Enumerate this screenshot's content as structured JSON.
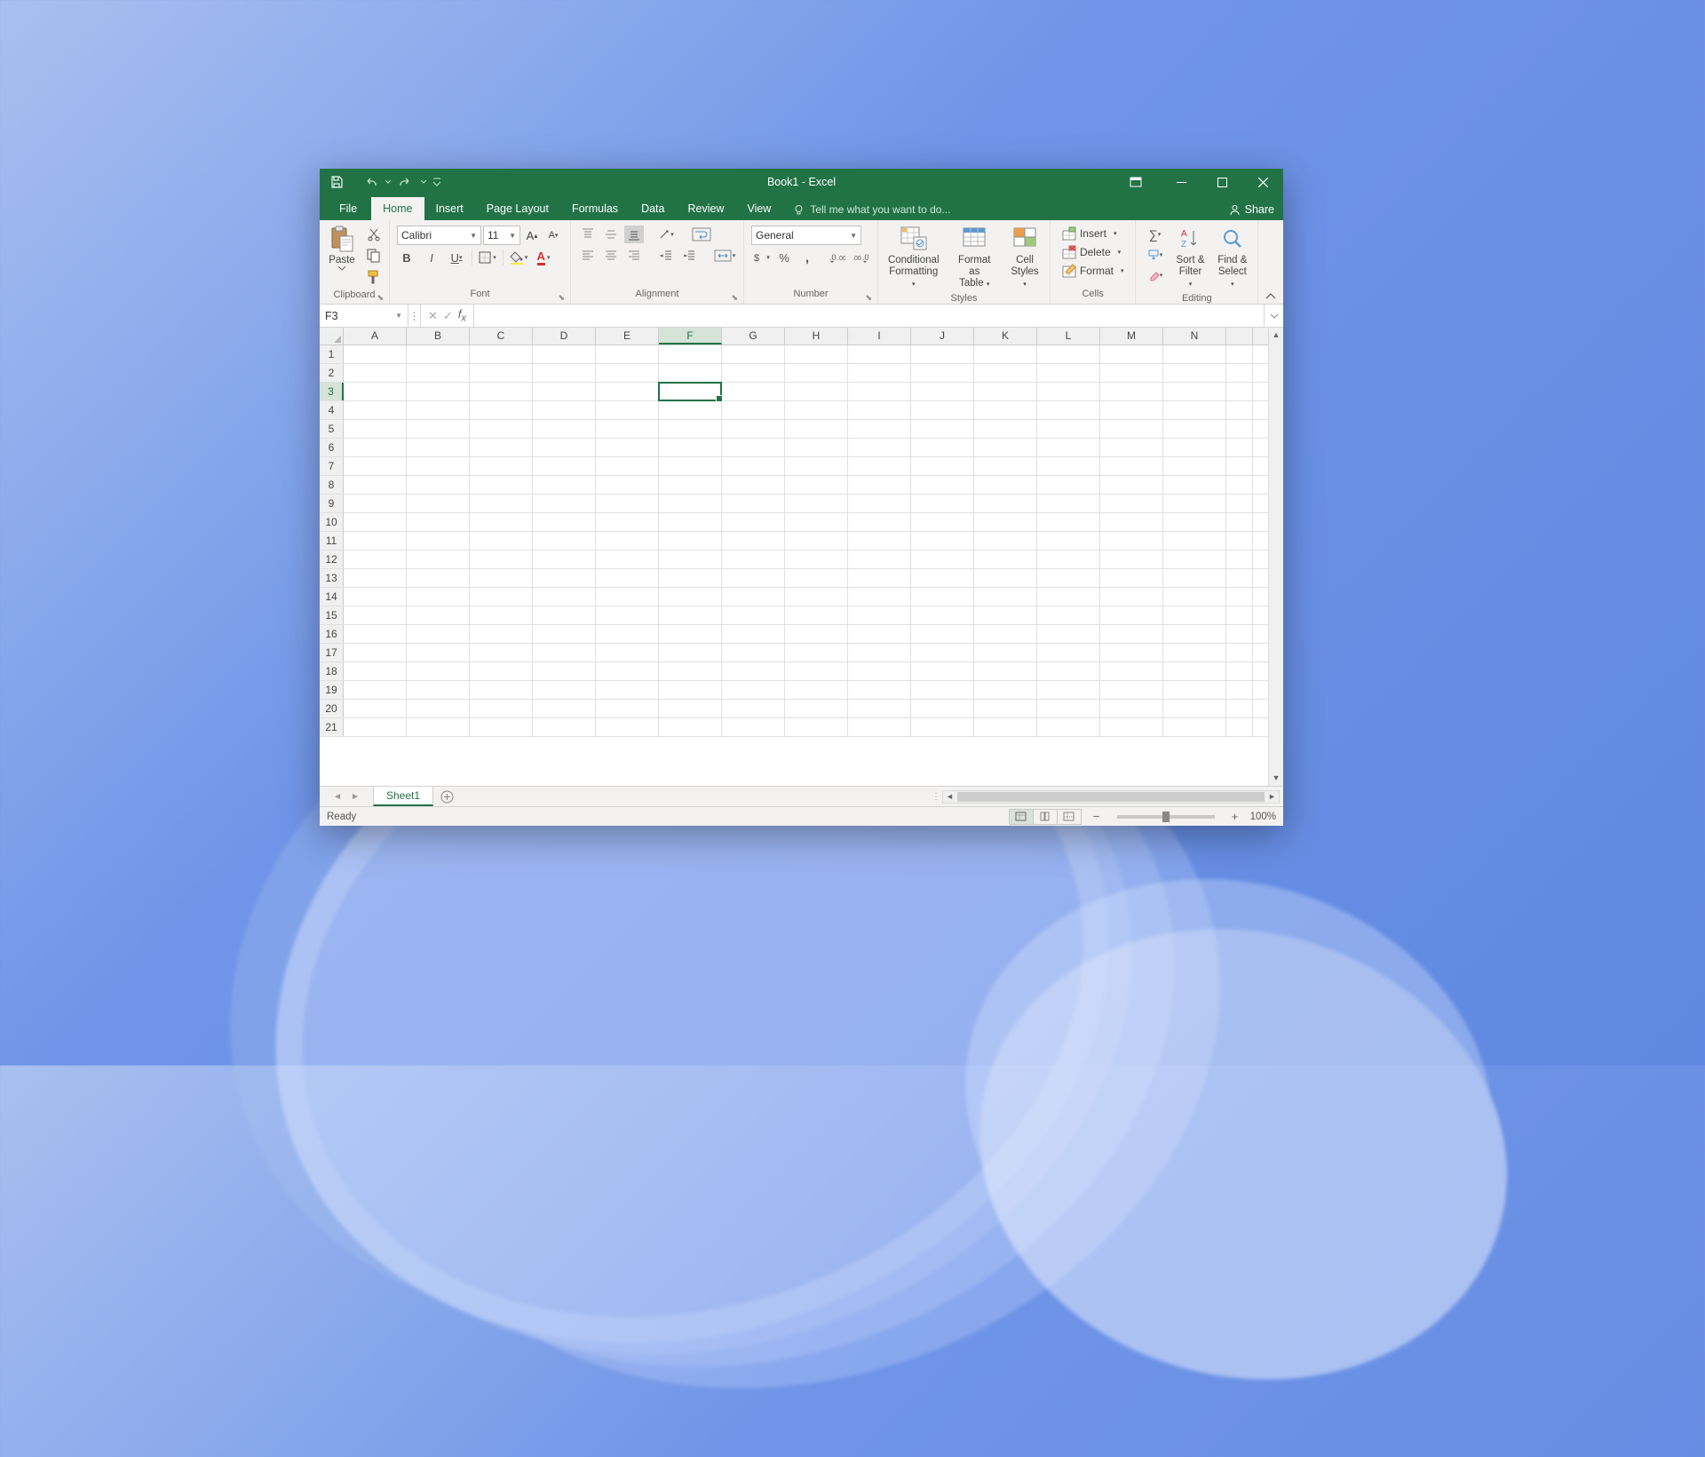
{
  "title": "Book1 - Excel",
  "tabs": {
    "file": "File",
    "home": "Home",
    "insert": "Insert",
    "page_layout": "Page Layout",
    "formulas": "Formulas",
    "data": "Data",
    "review": "Review",
    "view": "View"
  },
  "tellme": "Tell me what you want to do...",
  "share": "Share",
  "ribbon": {
    "clipboard": {
      "paste": "Paste",
      "label": "Clipboard"
    },
    "font": {
      "name": "Calibri",
      "size": "11",
      "label": "Font"
    },
    "alignment": {
      "label": "Alignment"
    },
    "number": {
      "format": "General",
      "label": "Number"
    },
    "styles": {
      "cond": "Conditional",
      "cond2": "Formatting",
      "fmt": "Format as",
      "fmt2": "Table",
      "cell": "Cell",
      "cell2": "Styles",
      "label": "Styles"
    },
    "cells": {
      "insert": "Insert",
      "delete": "Delete",
      "format": "Format",
      "label": "Cells"
    },
    "editing": {
      "sort": "Sort &",
      "sort2": "Filter",
      "find": "Find &",
      "find2": "Select",
      "label": "Editing"
    }
  },
  "name_box": "F3",
  "columns": [
    "A",
    "B",
    "C",
    "D",
    "E",
    "F",
    "G",
    "H",
    "I",
    "J",
    "K",
    "L",
    "M",
    "N"
  ],
  "rows": [
    1,
    2,
    3,
    4,
    5,
    6,
    7,
    8,
    9,
    10,
    11,
    12,
    13,
    14,
    15,
    16,
    17,
    18,
    19,
    20,
    21
  ],
  "active": {
    "col": 5,
    "row": 2
  },
  "sheet": "Sheet1",
  "status": "Ready",
  "zoom": "100%"
}
